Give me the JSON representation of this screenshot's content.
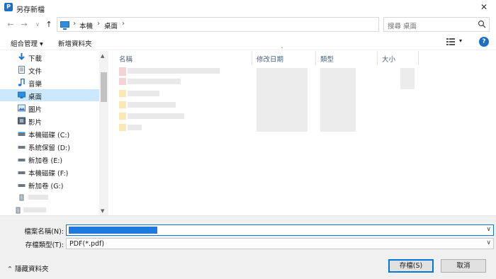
{
  "window": {
    "title": "另存新檔",
    "app_icon": "P"
  },
  "navigation": {
    "back_glyph": "←",
    "forward_glyph": "→",
    "recent_glyph": "∨",
    "up_glyph": "↑"
  },
  "address": {
    "sep_glyph": "›",
    "breadcrumbs": [
      "本機",
      "桌面"
    ],
    "drop_glyph": "∨",
    "refresh_glyph": "↻"
  },
  "search": {
    "placeholder": "搜尋 桌面"
  },
  "toolbar": {
    "organize": "組合管理 ▾",
    "new_folder": "新增資料夾",
    "view_drop": "▾",
    "help": "?"
  },
  "sidebar": {
    "items": [
      {
        "label": "下載",
        "icon": "download-icon"
      },
      {
        "label": "文件",
        "icon": "documents-icon"
      },
      {
        "label": "音樂",
        "icon": "music-icon"
      },
      {
        "label": "桌面",
        "icon": "desktop-icon",
        "selected": true
      },
      {
        "label": "圖片",
        "icon": "pictures-icon"
      },
      {
        "label": "影片",
        "icon": "videos-icon"
      },
      {
        "label": "本機磁碟 (C:)",
        "icon": "drive-icon"
      },
      {
        "label": "系統保留 (D:)",
        "icon": "drive-icon"
      },
      {
        "label": "新加卷 (E:)",
        "icon": "drive-icon"
      },
      {
        "label": "本機磁碟 (F:)",
        "icon": "drive-icon"
      },
      {
        "label": "新加卷 (G:)",
        "icon": "drive-icon"
      }
    ],
    "scroll_up": "▲",
    "scroll_down": "▼"
  },
  "file_list": {
    "columns": [
      "名稱",
      "修改日期",
      "類型",
      "大小"
    ],
    "sort_glyph": "ˇ"
  },
  "bottom": {
    "filename_label": "檔案名稱(N):",
    "filetype_label": "存檔類型(T):",
    "filetype_value": "PDF(*.pdf)",
    "combo_glyph": "∨",
    "hide_folders": "⌃ 隱藏資料夾",
    "save_button": "存檔(S)",
    "cancel_button": "取消"
  },
  "colors": {
    "accent": "#0078d7",
    "selected_row": "#cce8ff",
    "selection_fill": "#1f7ae0"
  }
}
